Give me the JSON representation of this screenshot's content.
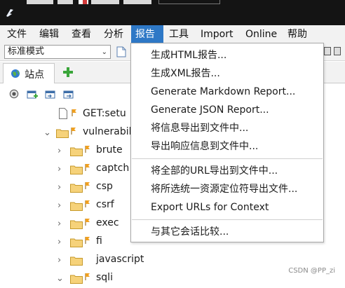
{
  "menubar": {
    "items": [
      "文件",
      "编辑",
      "查看",
      "分析",
      "报告",
      "工具",
      "Import",
      "Online",
      "帮助"
    ],
    "active_index": 4
  },
  "toolbar": {
    "mode_value": "标准模式"
  },
  "sites_panel": {
    "tab_label": "站点",
    "tab_icon": "globe-icon",
    "add_icon": "plus-icon"
  },
  "tree": {
    "rows": [
      {
        "label": "GET:setu",
        "type": "file"
      },
      {
        "label": "vulnerabil",
        "type": "folder-open"
      },
      {
        "label": "brute",
        "type": "folder"
      },
      {
        "label": "captch",
        "type": "folder"
      },
      {
        "label": "csp",
        "type": "folder"
      },
      {
        "label": "csrf",
        "type": "folder"
      },
      {
        "label": "exec",
        "type": "folder"
      },
      {
        "label": "fi",
        "type": "folder"
      },
      {
        "label": "javascript",
        "type": "folder"
      },
      {
        "label": "sqli",
        "type": "folder-open"
      }
    ]
  },
  "report_menu": {
    "items": [
      "生成HTML报告...",
      "生成XML报告...",
      "Generate Markdown Report...",
      "Generate JSON Report...",
      "将信息导出到文件中...",
      "导出响应信息到文件中...",
      "将全部的URL导出到文件中...",
      "将所选统一资源定位符导出文件...",
      "Export URLs for Context",
      "与其它会话比较..."
    ]
  },
  "watermark": "CSDN @PP_zi",
  "colors": {
    "menu_active": "#2e78c6",
    "folder": "#f3c35a",
    "flag": "#f0a020",
    "add": "#3aa63a"
  }
}
